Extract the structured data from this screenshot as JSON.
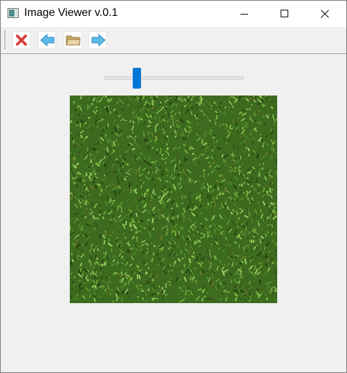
{
  "window": {
    "title": "Image Viewer v.0.1",
    "icon": "window-app-icon",
    "controls": [
      "minimize-icon",
      "maximize-icon",
      "close-icon"
    ]
  },
  "toolbar": {
    "buttons": [
      {
        "name": "close-image-button",
        "icon": "red-x-icon",
        "color": "#d9413a"
      },
      {
        "name": "previous-image-button",
        "icon": "arrow-left-icon",
        "color": "#3aa3dd"
      },
      {
        "name": "open-folder-button",
        "icon": "folder-icon",
        "color": "#d8c08a"
      },
      {
        "name": "next-image-button",
        "icon": "arrow-right-icon",
        "color": "#3aa3dd"
      }
    ]
  },
  "zoom_slider": {
    "value_fraction": 0.22,
    "handle_color": "#0078d7"
  },
  "image": {
    "subject": "grass-texture",
    "base_color": "#3c6a1e"
  }
}
